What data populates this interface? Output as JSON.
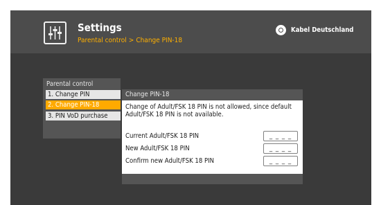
{
  "header": {
    "title": "Settings",
    "breadcrumb": [
      "Parental control",
      "Change PIN-18"
    ],
    "breadcrumb_separator": ">",
    "brand": "Kabel Deutschland",
    "icon": "settings-sliders-icon",
    "brand_icon": "kabel-deutschland-logo-icon"
  },
  "menu": {
    "title": "Parental control",
    "items": [
      {
        "label": "1. Change PIN",
        "selected": false
      },
      {
        "label": "2. Change PIN-18",
        "selected": true
      },
      {
        "label": "3. PIN VoD purchase",
        "selected": false
      }
    ]
  },
  "panel": {
    "title": "Change PIN-18",
    "notice": "Change of Adult/FSK 18 PIN is not allowed, since default Adult/FSK 18 PIN is not available.",
    "fields": [
      {
        "label": "Current Adult/FSK 18 PIN",
        "value": "_ _ _ _"
      },
      {
        "label": "New Adult/FSK 18 PIN",
        "value": "_ _ _ _"
      },
      {
        "label": "Confirm new Adult/FSK 18 PIN",
        "value": "_ _ _ _"
      }
    ]
  },
  "colors": {
    "background": "#3a3a3a",
    "header": "#4c4c4c",
    "accent": "#ffaa00",
    "breadcrumb": "#ffb000",
    "panel": "#555555"
  }
}
